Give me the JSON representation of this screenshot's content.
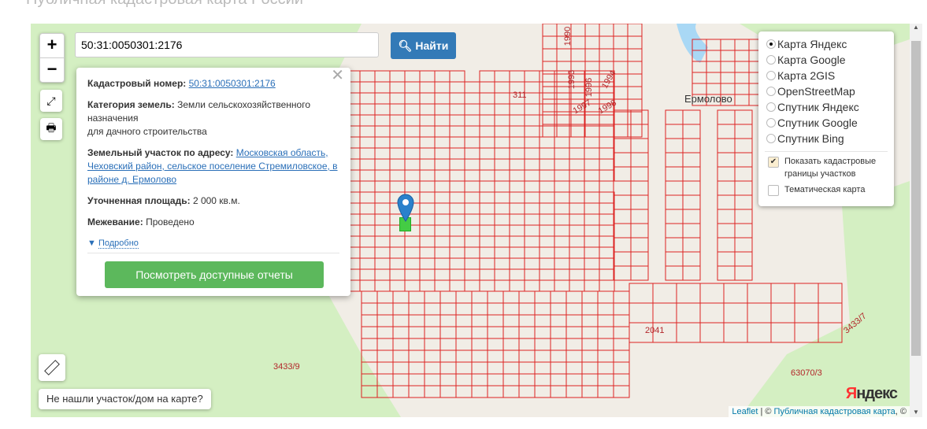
{
  "page_title": "Публичная кадастровая карта России",
  "search": {
    "value": "50:31:0050301:2176",
    "button": "Найти"
  },
  "zoom": {
    "in": "+",
    "out": "−"
  },
  "popup": {
    "cad_label": "Кадастровый номер:",
    "cad_value": "50:31:0050301:2176",
    "cat_label": "Категория земель:",
    "cat_value": "Земли сельскохозяйственного назначения",
    "cat_use": "для дачного строительства",
    "addr_label": "Земельный участок по адресу:",
    "addr_value": "Московская область, Чеховский район, сельское поселение Стремиловское, в районе д. Ермолово",
    "area_label": "Уточненная площадь:",
    "area_value": "2 000 кв.м.",
    "survey_label": "Межевание:",
    "survey_value": "Проведено",
    "more": "Подробно",
    "reports_button": "Посмотреть доступные отчеты"
  },
  "layers": {
    "base": [
      {
        "label": "Карта Яндекс",
        "selected": true
      },
      {
        "label": "Карта Google",
        "selected": false
      },
      {
        "label": "Карта 2GIS",
        "selected": false
      },
      {
        "label": "OpenStreetMap",
        "selected": false
      },
      {
        "label": "Спутник Яндекс",
        "selected": false
      },
      {
        "label": "Спутник Google",
        "selected": false
      },
      {
        "label": "Спутник Bing",
        "selected": false
      }
    ],
    "overlays": [
      {
        "label": "Показать кадастровые границы участков",
        "checked": true
      },
      {
        "label": "Тематическая карта",
        "checked": false
      }
    ]
  },
  "map_labels": {
    "village": "Ермолово",
    "l311": "311",
    "l2041": "2041",
    "l3433_9": "3433/9",
    "l63070_3": "63070/3",
    "l3433_7": "3433/7",
    "l1990": "1990",
    "l1993": "1993",
    "l1996": "1996",
    "l1994": "1994",
    "l1997": "1997",
    "l1998": "1998"
  },
  "not_found": "Не нашли участок/дом на карте?",
  "yandex_logo": "Яндекс",
  "attribution": {
    "leaflet": "Leaflet",
    "sep": " | © ",
    "pkk": "Публичная кадастровая карта",
    "tail": ", ©"
  },
  "colors": {
    "parcel": "#d22",
    "green": "#d4efc2",
    "accent": "#337ab7",
    "report": "#5cb85c"
  }
}
